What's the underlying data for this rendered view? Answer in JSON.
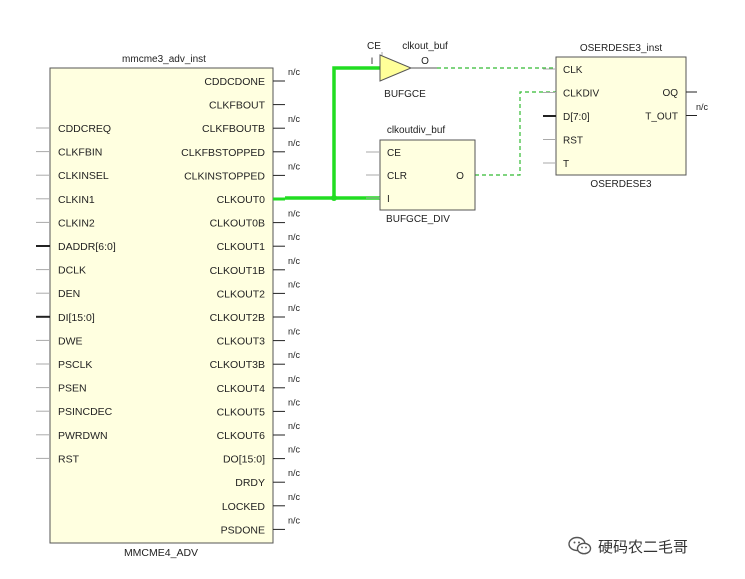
{
  "mmcm": {
    "instance_name": "mmcme3_adv_inst",
    "cell_type": "MMCME4_ADV",
    "left_ports": [
      "CDDCREQ",
      "CLKFBIN",
      "CLKINSEL",
      "CLKIN1",
      "CLKIN2",
      "DADDR[6:0]",
      "DCLK",
      "DEN",
      "DI[15:0]",
      "DWE",
      "PSCLK",
      "PSEN",
      "PSINCDEC",
      "PWRDWN",
      "RST"
    ],
    "bus_inputs": [
      "DADDR[6:0]",
      "DI[15:0]"
    ],
    "right_ports": [
      "CDDCDONE",
      "CLKFBOUT",
      "CLKFBOUTB",
      "CLKFBSTOPPED",
      "CLKINSTOPPED",
      "CLKOUT0",
      "CLKOUT0B",
      "CLKOUT1",
      "CLKOUT1B",
      "CLKOUT2",
      "CLKOUT2B",
      "CLKOUT3",
      "CLKOUT3B",
      "CLKOUT4",
      "CLKOUT5",
      "CLKOUT6",
      "DO[15:0]",
      "DRDY",
      "LOCKED",
      "PSDONE"
    ],
    "nc_outputs": [
      "CDDCDONE",
      "CLKFBOUTB",
      "CLKFBSTOPPED",
      "CLKINSTOPPED",
      "CLKOUT0B",
      "CLKOUT1",
      "CLKOUT1B",
      "CLKOUT2",
      "CLKOUT2B",
      "CLKOUT3",
      "CLKOUT3B",
      "CLKOUT4",
      "CLKOUT5",
      "CLKOUT6",
      "DO[15:0]",
      "DRDY",
      "LOCKED",
      "PSDONE"
    ]
  },
  "nc_label": "n/c",
  "bufgce": {
    "instance_name": "clkout_buf",
    "cell_type": "BUFGCE",
    "ce_label": "CE",
    "in_label": "I",
    "out_label": "O"
  },
  "bufgce_div": {
    "instance_name": "clkoutdiv_buf",
    "cell_type": "BUFGCE_DIV",
    "inputs": [
      "CE",
      "CLR",
      "I"
    ],
    "out_label": "O"
  },
  "oserdes": {
    "instance_name": "OSERDESE3_inst",
    "cell_type": "OSERDESE3",
    "inputs": [
      "CLK",
      "CLKDIV",
      "D[7:0]",
      "RST",
      "T"
    ],
    "outputs": [
      "OQ",
      "T_OUT"
    ]
  },
  "watermark": {
    "text": "硬码农二毛哥",
    "icon": "wechat-icon"
  },
  "colors": {
    "block_fill": "#ffffe0",
    "block_stroke": "#555555",
    "selected_net": "#22dd22",
    "clock_net": "#33bb33",
    "bufgce_fill": "#ffff99",
    "pin_gray": "#aaaaaa"
  }
}
